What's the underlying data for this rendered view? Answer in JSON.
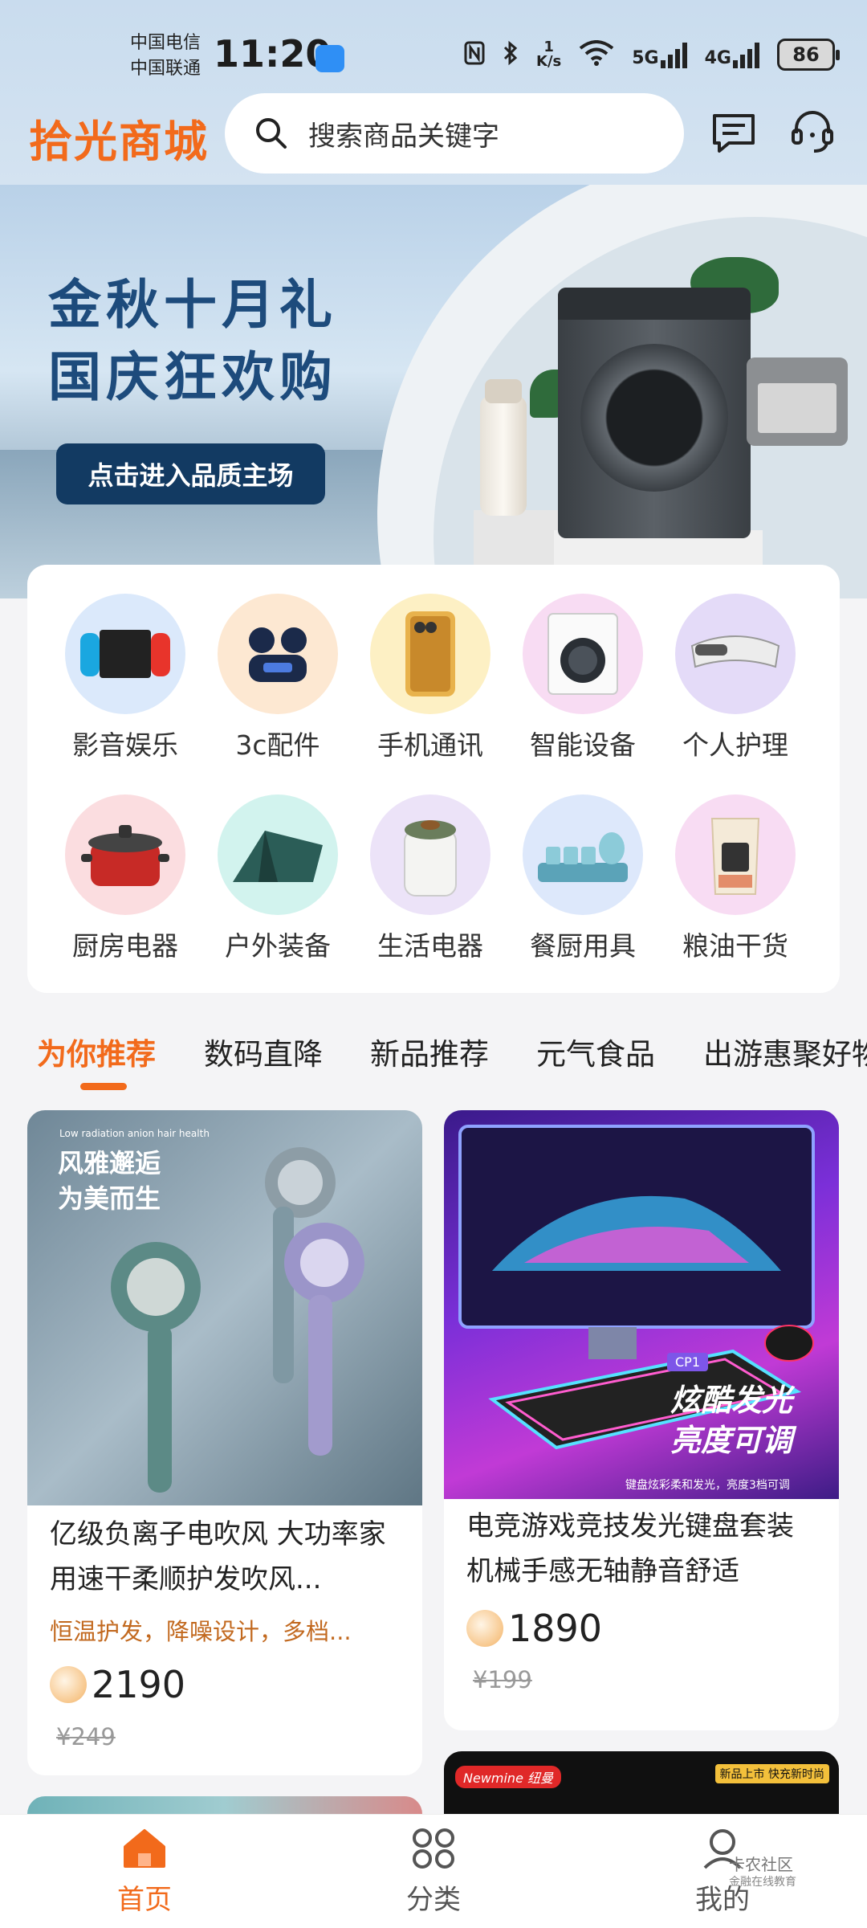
{
  "status_bar": {
    "carrier_1": "中国电信",
    "carrier_2": "中国联通",
    "time": "11:20",
    "net_speed_value": "1",
    "net_speed_unit": "K/s",
    "sig1": "5G",
    "sig2": "4G",
    "battery": "86"
  },
  "header": {
    "brand": "拾光商城",
    "search_placeholder": "搜索商品关键字"
  },
  "banner": {
    "title_line1": "金秋十月礼",
    "title_line2": "国庆狂欢购",
    "button": "点击进入品质主场"
  },
  "categories": [
    {
      "label": "影音娱乐",
      "icon": "game-console-icon"
    },
    {
      "label": "3c配件",
      "icon": "earbuds-icon"
    },
    {
      "label": "手机通讯",
      "icon": "phone-icon"
    },
    {
      "label": "智能设备",
      "icon": "washing-machine-icon"
    },
    {
      "label": "个人护理",
      "icon": "eye-massager-icon"
    },
    {
      "label": "厨房电器",
      "icon": "pressure-cooker-icon"
    },
    {
      "label": "户外装备",
      "icon": "tent-icon"
    },
    {
      "label": "生活电器",
      "icon": "humidifier-icon"
    },
    {
      "label": "餐厨用具",
      "icon": "tea-set-icon"
    },
    {
      "label": "粮油干货",
      "icon": "rice-bag-icon"
    }
  ],
  "tabs": [
    "为你推荐",
    "数码直降",
    "新品推荐",
    "元气食品",
    "出游惠聚好物"
  ],
  "products": [
    {
      "title": "亿级负离子电吹风 大功率家用速干柔顺护发吹风...",
      "subtitle": "恒温护发，降噪设计，多档...",
      "price": "2190",
      "old_price": "¥249",
      "img_tag": "Low radiation anion hair health",
      "img_text1": "风雅邂逅",
      "img_text2": "为美而生"
    },
    {
      "title": "电竞游戏竞技发光键盘套装 机械手感无轴静音舒适",
      "price": "1890",
      "old_price": "¥199",
      "img_text1": "炫酷发光",
      "img_text2": "亮度可调",
      "img_caption": "键盘炫彩柔和发光，亮度3档可调",
      "img_badge": "CP1"
    },
    {
      "img_brand": "Newmine 纽曼",
      "img_tag": "新品上市 快充新时尚"
    }
  ],
  "bottom_nav": [
    {
      "label": "首页",
      "icon": "home-icon"
    },
    {
      "label": "分类",
      "icon": "category-icon"
    },
    {
      "label": "我的",
      "icon": "profile-icon"
    }
  ],
  "watermark": {
    "line1": "卡农社区",
    "line2": "金融在线教育"
  },
  "colors": {
    "accent": "#f26a1b",
    "banner_button": "#123a62"
  }
}
